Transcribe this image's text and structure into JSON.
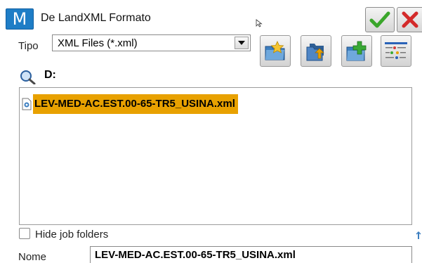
{
  "window": {
    "title": "De LandXML Formato",
    "logo_letter": "M"
  },
  "tipo": {
    "label": "Tipo",
    "selected": "XML Files (*.xml)"
  },
  "path": {
    "drive": "D:"
  },
  "files": [
    {
      "name": "LEV-MED-AC.EST.00-65-TR5_USINA.xml",
      "selected": true
    }
  ],
  "hide_job_folders": {
    "label": "Hide job folders",
    "checked": false
  },
  "nome": {
    "label": "Nome",
    "value": "LEV-MED-AC.EST.00-65-TR5_USINA.xml"
  },
  "colors": {
    "accent": "#1e7dc6",
    "selection": "#e8a100",
    "ok_green": "#3aa62b",
    "cancel_red": "#d32a2a"
  }
}
